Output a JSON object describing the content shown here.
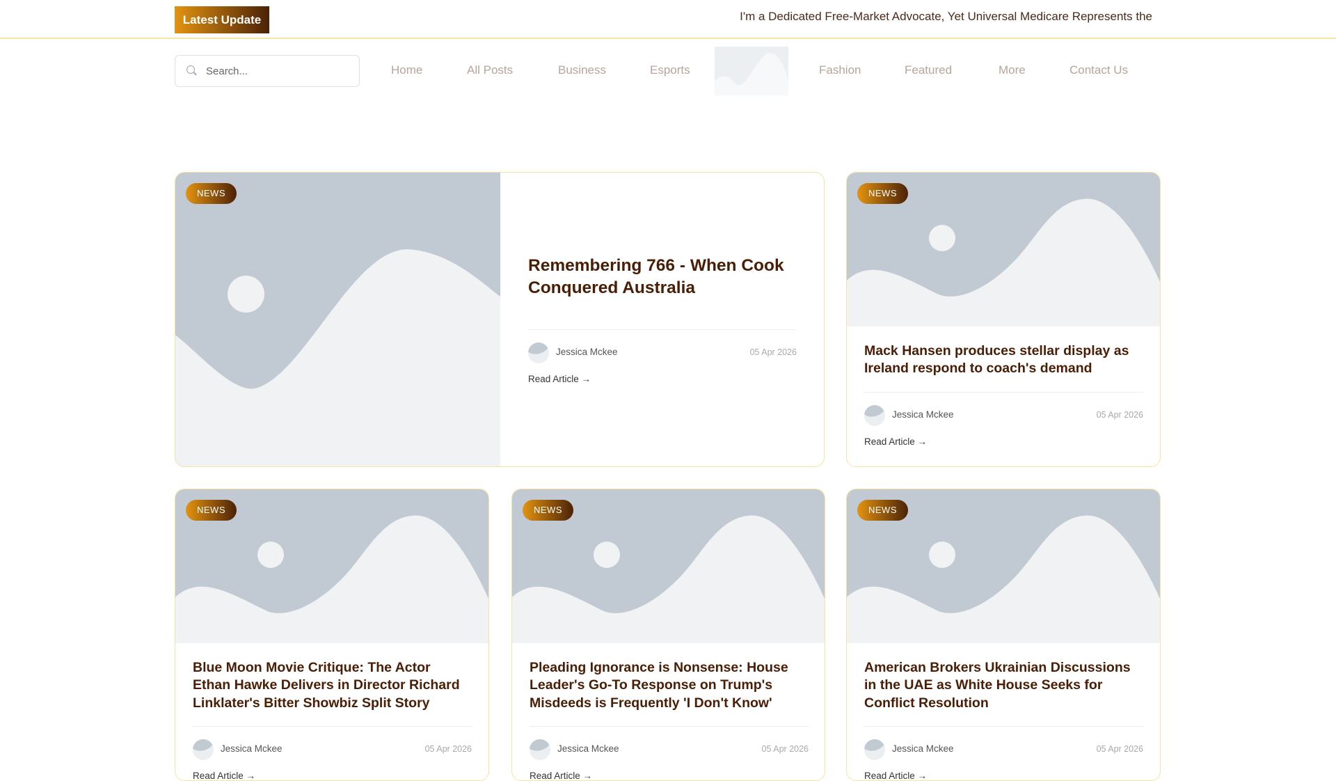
{
  "topbar": {
    "latest_label": "Latest Update",
    "ticker": "I'm a Dedicated Free-Market Advocate, Yet Universal Medicare Represents the"
  },
  "search": {
    "placeholder": "Search..."
  },
  "nav": {
    "items": [
      "Home",
      "All Posts",
      "Business",
      "Esports",
      "Fashion",
      "Featured",
      "More",
      "Contact Us"
    ]
  },
  "colors": {
    "accent_start": "#e39310",
    "accent_end": "#4a2208",
    "title": "#4a1d05",
    "border": "#f6e3a0"
  },
  "articles": [
    {
      "badge": "NEWS",
      "title": "Remembering 766 - When Cook Conquered Australia",
      "author": "Jessica Mckee",
      "date": "05 Apr 2026",
      "read": "Read Article →"
    },
    {
      "badge": "NEWS",
      "title": "Mack Hansen produces stellar display as Ireland respond to coach's demand",
      "author": "Jessica Mckee",
      "date": "05 Apr 2026",
      "read": "Read Article →"
    },
    {
      "badge": "NEWS",
      "title": "Blue Moon Movie Critique: The Actor Ethan Hawke Delivers in Director Richard Linklater's Bitter Showbiz Split Story",
      "author": "Jessica Mckee",
      "date": "05 Apr 2026",
      "read": "Read Article →"
    },
    {
      "badge": "NEWS",
      "title": "Pleading Ignorance is Nonsense: House Leader's Go-To Response on Trump's Misdeeds is Frequently 'I Don't Know'",
      "author": "Jessica Mckee",
      "date": "05 Apr 2026",
      "read": "Read Article →"
    },
    {
      "badge": "NEWS",
      "title": "American Brokers Ukrainian Discussions in the UAE as White House Seeks for Conflict Resolution",
      "author": "Jessica Mckee",
      "date": "05 Apr 2026",
      "read": "Read Article →"
    }
  ]
}
